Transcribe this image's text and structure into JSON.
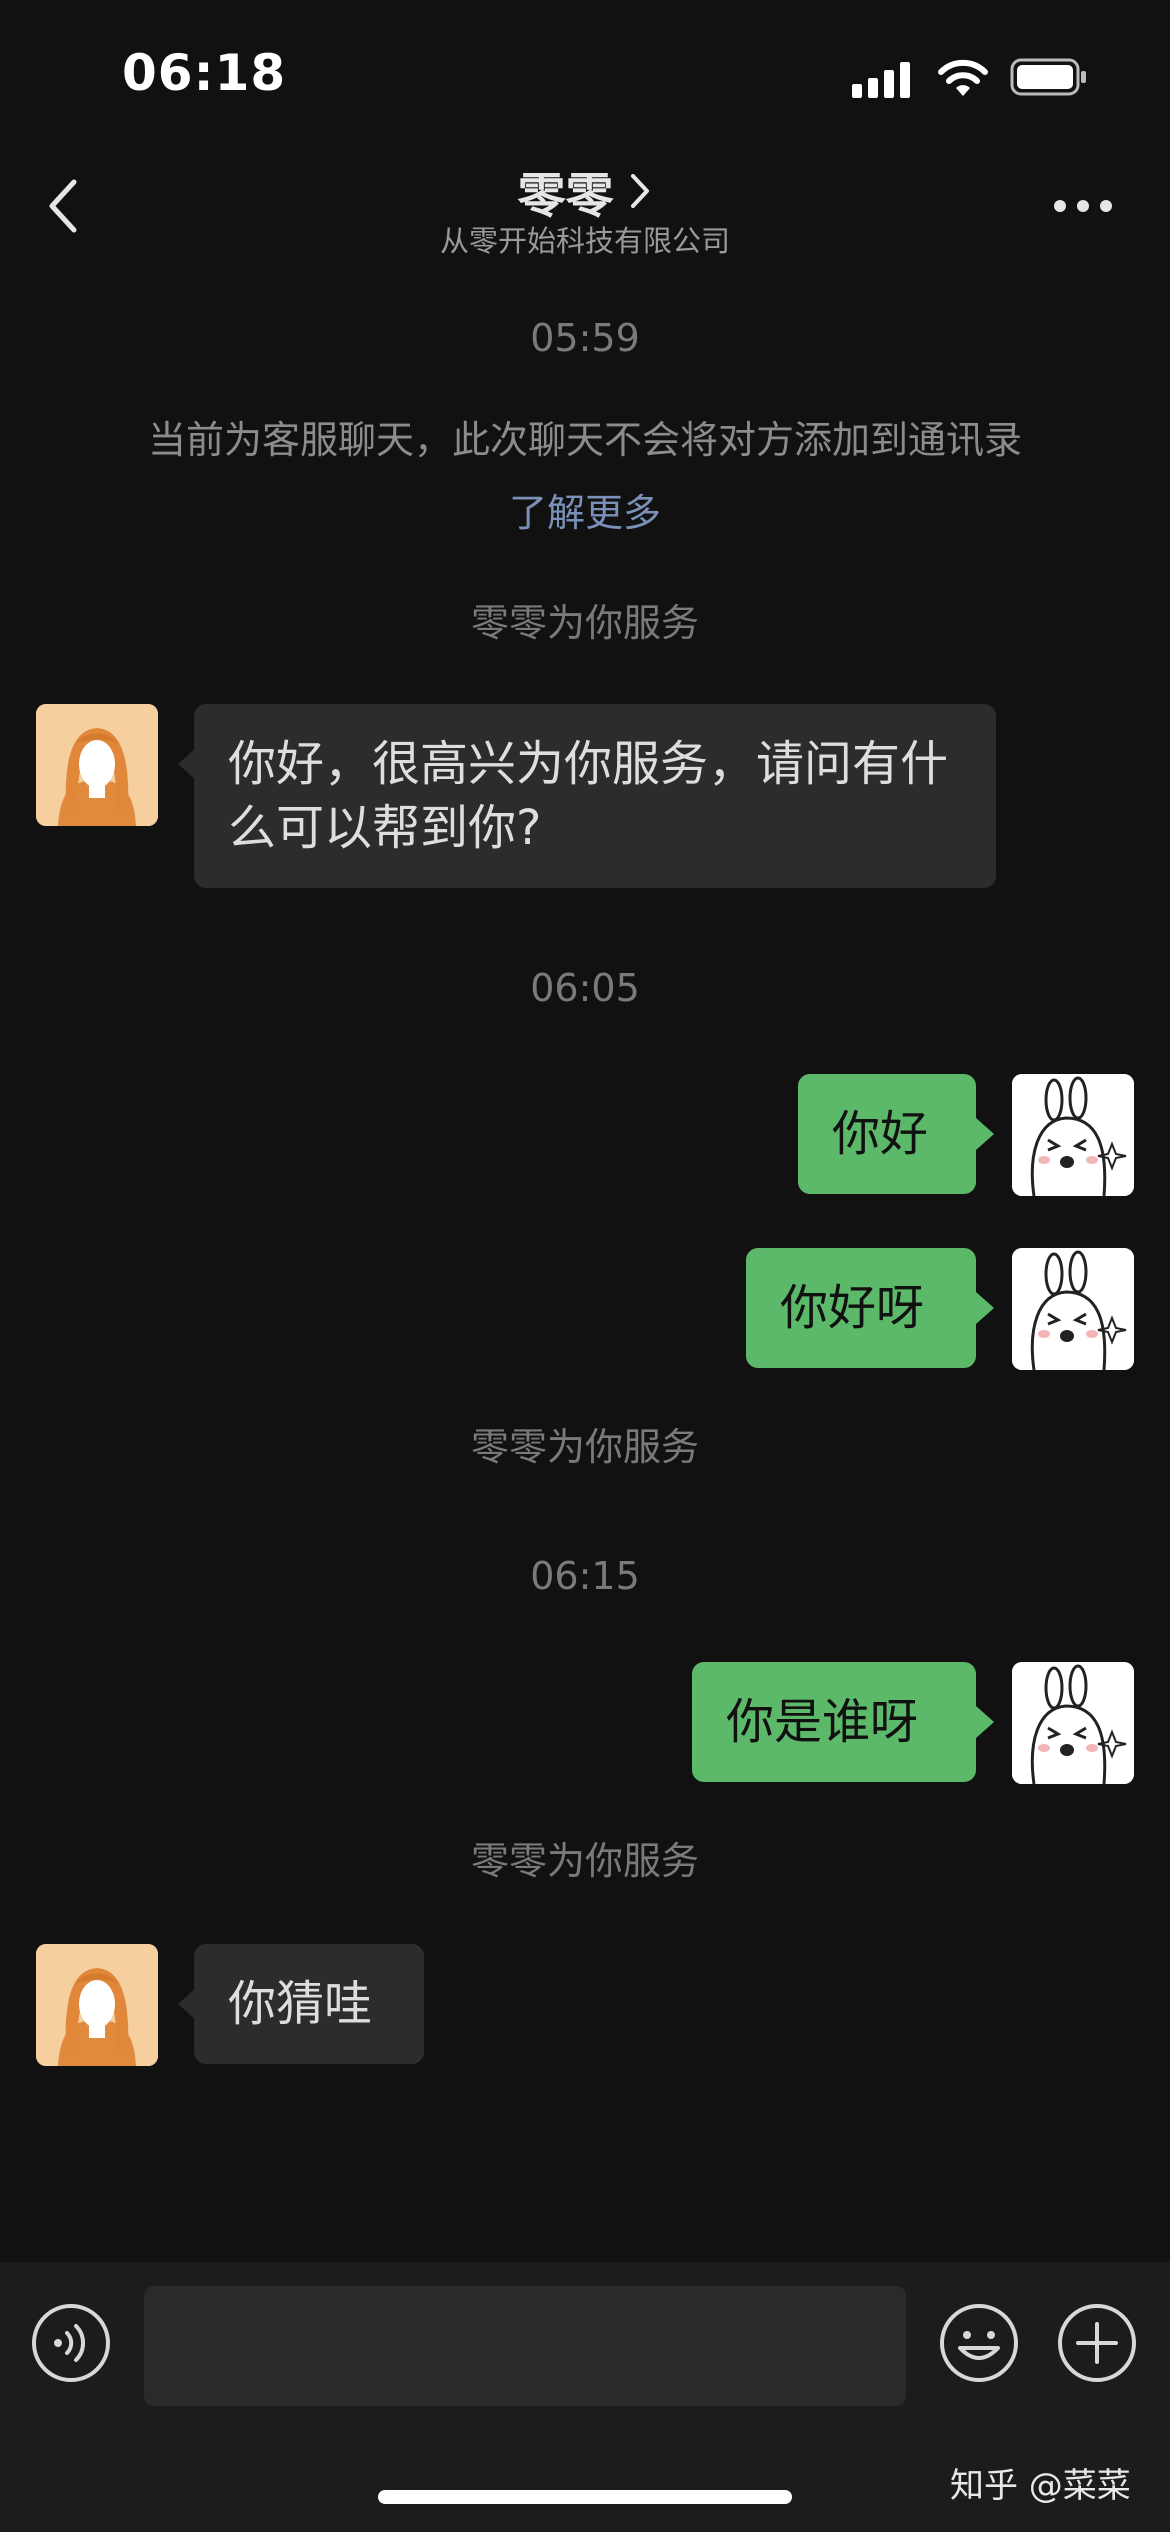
{
  "status_bar": {
    "time": "06:18"
  },
  "header": {
    "title": "零零",
    "subtitle": "从零开始科技有限公司"
  },
  "messages": {
    "time_1": "05:59",
    "notice": "当前为客服聊天，此次聊天不会将对方添加到通讯录",
    "notice_link": "了解更多",
    "service_1": "零零为你服务",
    "agent_msg_1": "你好，很高兴为你服务，请问有什么可以帮到你?",
    "time_2": "06:05",
    "user_msg_1": "你好",
    "user_msg_2": "你好呀",
    "service_2": "零零为你服务",
    "time_3": "06:15",
    "user_msg_3": "你是谁呀",
    "service_3": "零零为你服务",
    "agent_msg_2": "你猜哇"
  },
  "watermark": "知乎 @菜菜",
  "icons": {
    "back": "chevron-left-icon",
    "more": "more-dots-icon",
    "voice": "voice-icon",
    "emoji": "emoji-icon",
    "plus": "plus-icon"
  },
  "colors": {
    "background": "#111111",
    "incoming_bubble": "#2c2c2c",
    "outgoing_bubble": "#5cb96a",
    "link": "#7b90b8",
    "input_bar": "#1c1c1c"
  }
}
